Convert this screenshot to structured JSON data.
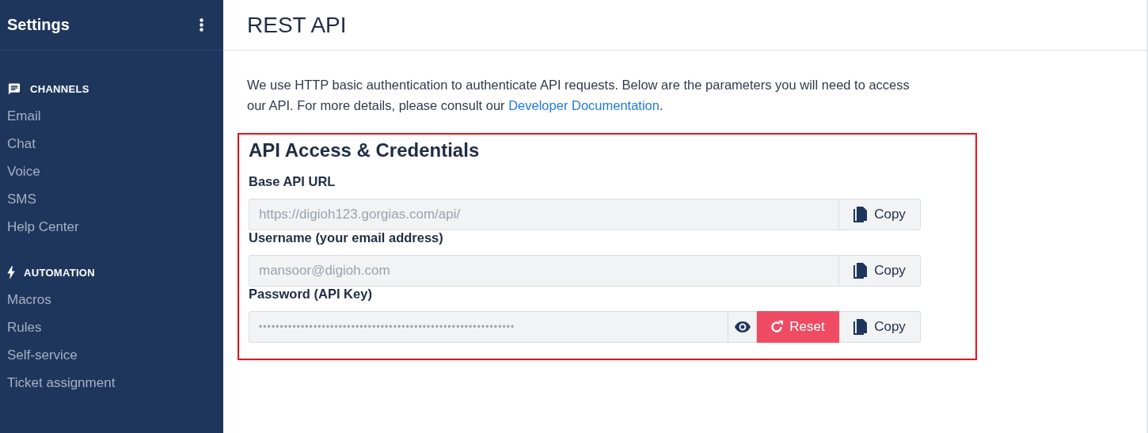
{
  "sidebar": {
    "title": "Settings",
    "sections": [
      {
        "kind": "chat",
        "heading": "CHANNELS",
        "items": [
          "Email",
          "Chat",
          "Voice",
          "SMS",
          "Help Center"
        ]
      },
      {
        "kind": "bolt",
        "heading": "AUTOMATION",
        "items": [
          "Macros",
          "Rules",
          "Self-service",
          "Ticket assignment"
        ]
      }
    ]
  },
  "page": {
    "title": "REST API",
    "intro": "We use HTTP basic authentication to authenticate API requests. Below are the parameters you will need to access our API. For more details, please consult our ",
    "intro_link": "Developer Documentation",
    "intro_end": ".",
    "card": {
      "title": "API Access & Credentials",
      "highlighted": true,
      "fields": [
        {
          "kind": "text",
          "label": "Base API URL",
          "value": "https://digioh123.gorgias.com/api/",
          "copy": "Copy"
        },
        {
          "kind": "text",
          "label": "Username (your email address)",
          "value": "mansoor@digioh.com",
          "copy": "Copy"
        },
        {
          "kind": "secret",
          "label": "Password (API Key)",
          "value": "•••••••••••••••••••••••••••••••••••••••••••••••••••••••••••••",
          "reset": "Reset",
          "copy": "Copy"
        }
      ]
    }
  }
}
